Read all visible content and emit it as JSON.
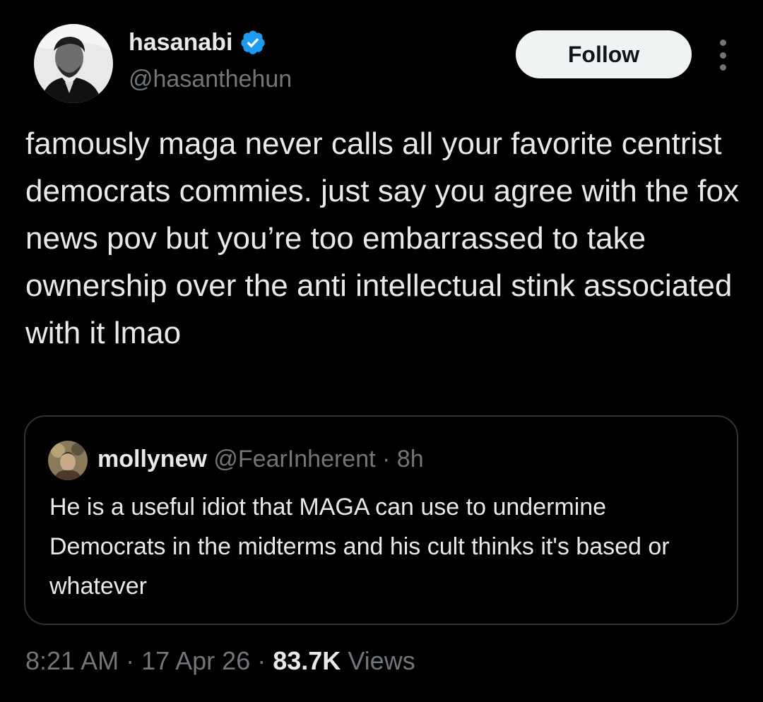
{
  "author": {
    "display_name": "hasanabi",
    "handle": "@hasanthehun",
    "verified": true,
    "verified_color": "#1d9bf0",
    "avatar_icon": "profile-photo-grayscale"
  },
  "actions": {
    "follow_label": "Follow",
    "more_icon": "more-dots-icon"
  },
  "tweet": {
    "text": "famously maga never calls all your favorite centrist democrats commies. just say you agree with the fox news pov but you’re too embarrassed to take ownership over the anti intellectual stink associated with it lmao"
  },
  "quoted_tweet": {
    "display_name": "mollynew",
    "handle": "@FearInherent",
    "separator": " · ",
    "time": "8h",
    "text": "He is a useful idiot that MAGA can use to undermine Democrats in the midterms and his cult thinks it's based or whatever"
  },
  "footer": {
    "time": "8:21 AM",
    "date": "17 Apr 26",
    "views_count": "83.7K",
    "views_label": "Views"
  },
  "colors": {
    "background": "#000000",
    "text": "#e7e9ea",
    "secondary": "#71767b",
    "border": "#2f3336",
    "button_bg": "#eff3f4"
  }
}
